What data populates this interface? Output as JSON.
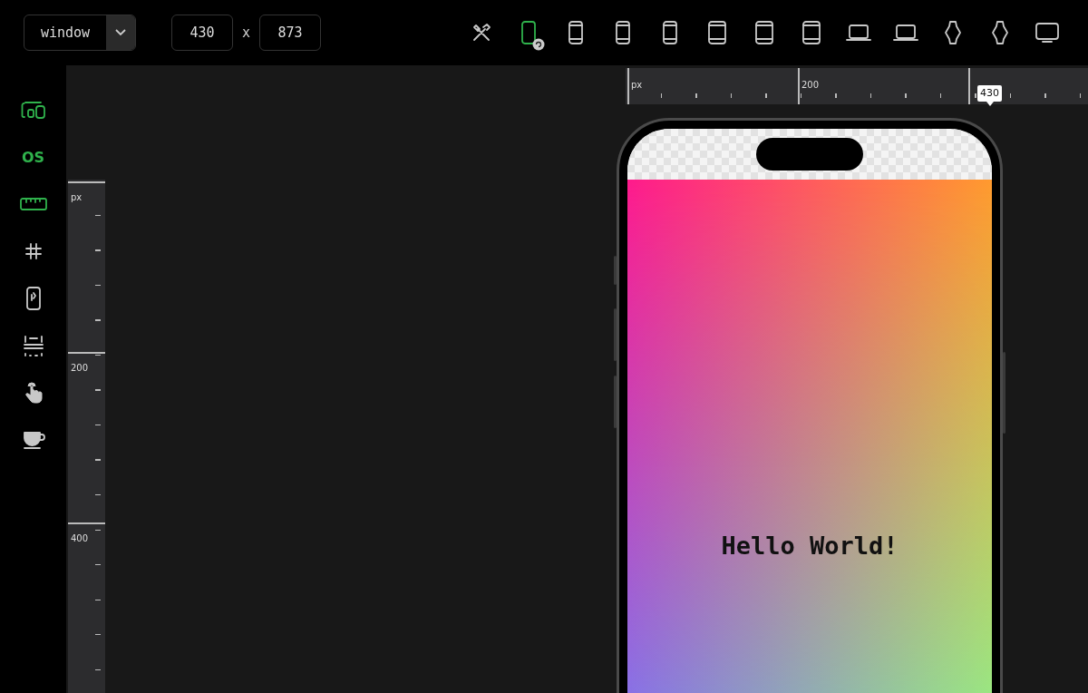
{
  "toolbar": {
    "mode_select": {
      "value": "window"
    },
    "width_field": {
      "value": "430"
    },
    "size_separator": "x",
    "height_field": {
      "value": "873"
    },
    "devices": [
      {
        "kind": "tools",
        "selected": false
      },
      {
        "kind": "phone",
        "selected": true
      },
      {
        "kind": "phone",
        "selected": false
      },
      {
        "kind": "phone",
        "selected": false
      },
      {
        "kind": "phone",
        "selected": false
      },
      {
        "kind": "tablet",
        "selected": false
      },
      {
        "kind": "tablet",
        "selected": false
      },
      {
        "kind": "tablet",
        "selected": false
      },
      {
        "kind": "laptop",
        "selected": false
      },
      {
        "kind": "laptop",
        "selected": false
      },
      {
        "kind": "watch",
        "selected": false
      },
      {
        "kind": "watch",
        "selected": false
      },
      {
        "kind": "monitor",
        "selected": false
      }
    ]
  },
  "sidebar": {
    "items": [
      {
        "kind": "device",
        "on": true
      },
      {
        "kind": "os",
        "label": "OS",
        "on": true
      },
      {
        "kind": "ruler",
        "on": true
      },
      {
        "kind": "grid",
        "on": false
      },
      {
        "kind": "frame",
        "on": false
      },
      {
        "kind": "layout",
        "on": false
      },
      {
        "kind": "touch",
        "on": false
      },
      {
        "kind": "cup",
        "on": false
      }
    ]
  },
  "horizontal_ruler": {
    "labels": [
      "px",
      "200"
    ],
    "width_marker": "430"
  },
  "vertical_ruler": {
    "labels": [
      "px",
      "200",
      "400"
    ]
  },
  "phone": {
    "text": "Hello World!"
  }
}
